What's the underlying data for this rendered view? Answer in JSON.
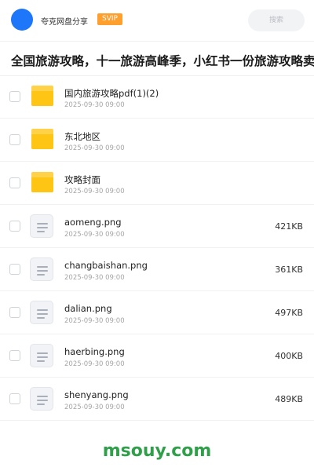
{
  "header": {
    "owner_name": "夸克网盘分享",
    "badge": "SVIP",
    "search_placeholder": "搜索",
    "accent_color": "#1e77f8",
    "badge_color": "#ff9f2e"
  },
  "title": "全国旅游攻略，十一旅游高峰季，小红书一份旅游攻略卖",
  "files": [
    {
      "name": "国内旅游攻略pdf(1)(2)",
      "date": "2025-09-30 09:00",
      "size": "",
      "type": "folder-icon"
    },
    {
      "name": "东北地区",
      "date": "2025-09-30 09:00",
      "size": "",
      "type": "folder-icon"
    },
    {
      "name": "攻略封面",
      "date": "2025-09-30 09:00",
      "size": "",
      "type": "folder-icon"
    },
    {
      "name": "aomeng.png",
      "date": "2025-09-30 09:00",
      "size": "421KB",
      "type": "document-icon"
    },
    {
      "name": "changbaishan.png",
      "date": "2025-09-30 09:00",
      "size": "361KB",
      "type": "document-icon"
    },
    {
      "name": "dalian.png",
      "date": "2025-09-30 09:00",
      "size": "497KB",
      "type": "document-icon"
    },
    {
      "name": "haerbing.png",
      "date": "2025-09-30 09:00",
      "size": "400KB",
      "type": "document-icon"
    },
    {
      "name": "shenyang.png",
      "date": "2025-09-30 09:00",
      "size": "489KB",
      "type": "document-icon"
    }
  ],
  "footer": {
    "watermark": "msouy.com",
    "color": "#2f9f49"
  }
}
